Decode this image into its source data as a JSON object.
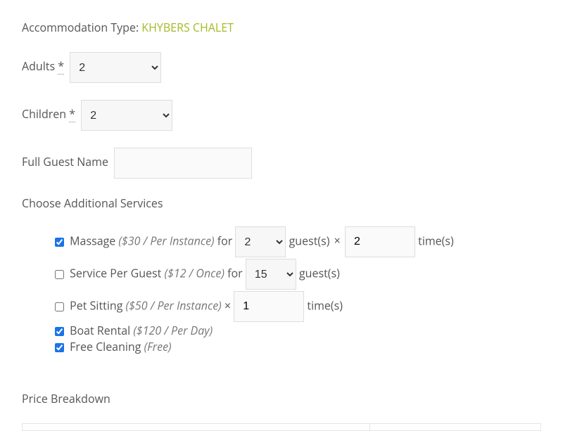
{
  "accommodation": {
    "label": "Accommodation Type: ",
    "name": "KHYBERS CHALET"
  },
  "adults": {
    "label": "Adults ",
    "req": "*",
    "value": "2"
  },
  "children": {
    "label": "Children ",
    "req": "*",
    "value": "2"
  },
  "fullname": {
    "label": "Full Guest Name",
    "value": ""
  },
  "services_header": "Choose Additional Services",
  "services": {
    "massage": {
      "checked": true,
      "name": "Massage ",
      "price": "($30 / Per Instance)",
      "for": " for ",
      "guests_value": "2",
      "guests_suffix": " guest(s) ",
      "times_sep": "× ",
      "times_value": "2",
      "times_suffix": " time(s)"
    },
    "perguest": {
      "checked": false,
      "name": "Service Per Guest ",
      "price": "($12 / Once)",
      "for": " for ",
      "guests_value": "15",
      "guests_suffix": " guest(s)"
    },
    "petsitting": {
      "checked": false,
      "name": "Pet Sitting ",
      "price": "($50 / Per Instance)",
      "times_sep": " × ",
      "times_value": "1",
      "times_suffix": " time(s)"
    },
    "boat": {
      "checked": true,
      "name": "Boat Rental ",
      "price": "($120 / Per Day)"
    },
    "cleaning": {
      "checked": true,
      "name": "Free Cleaning ",
      "price": "(Free)"
    }
  },
  "price_breakdown_header": "Price Breakdown"
}
